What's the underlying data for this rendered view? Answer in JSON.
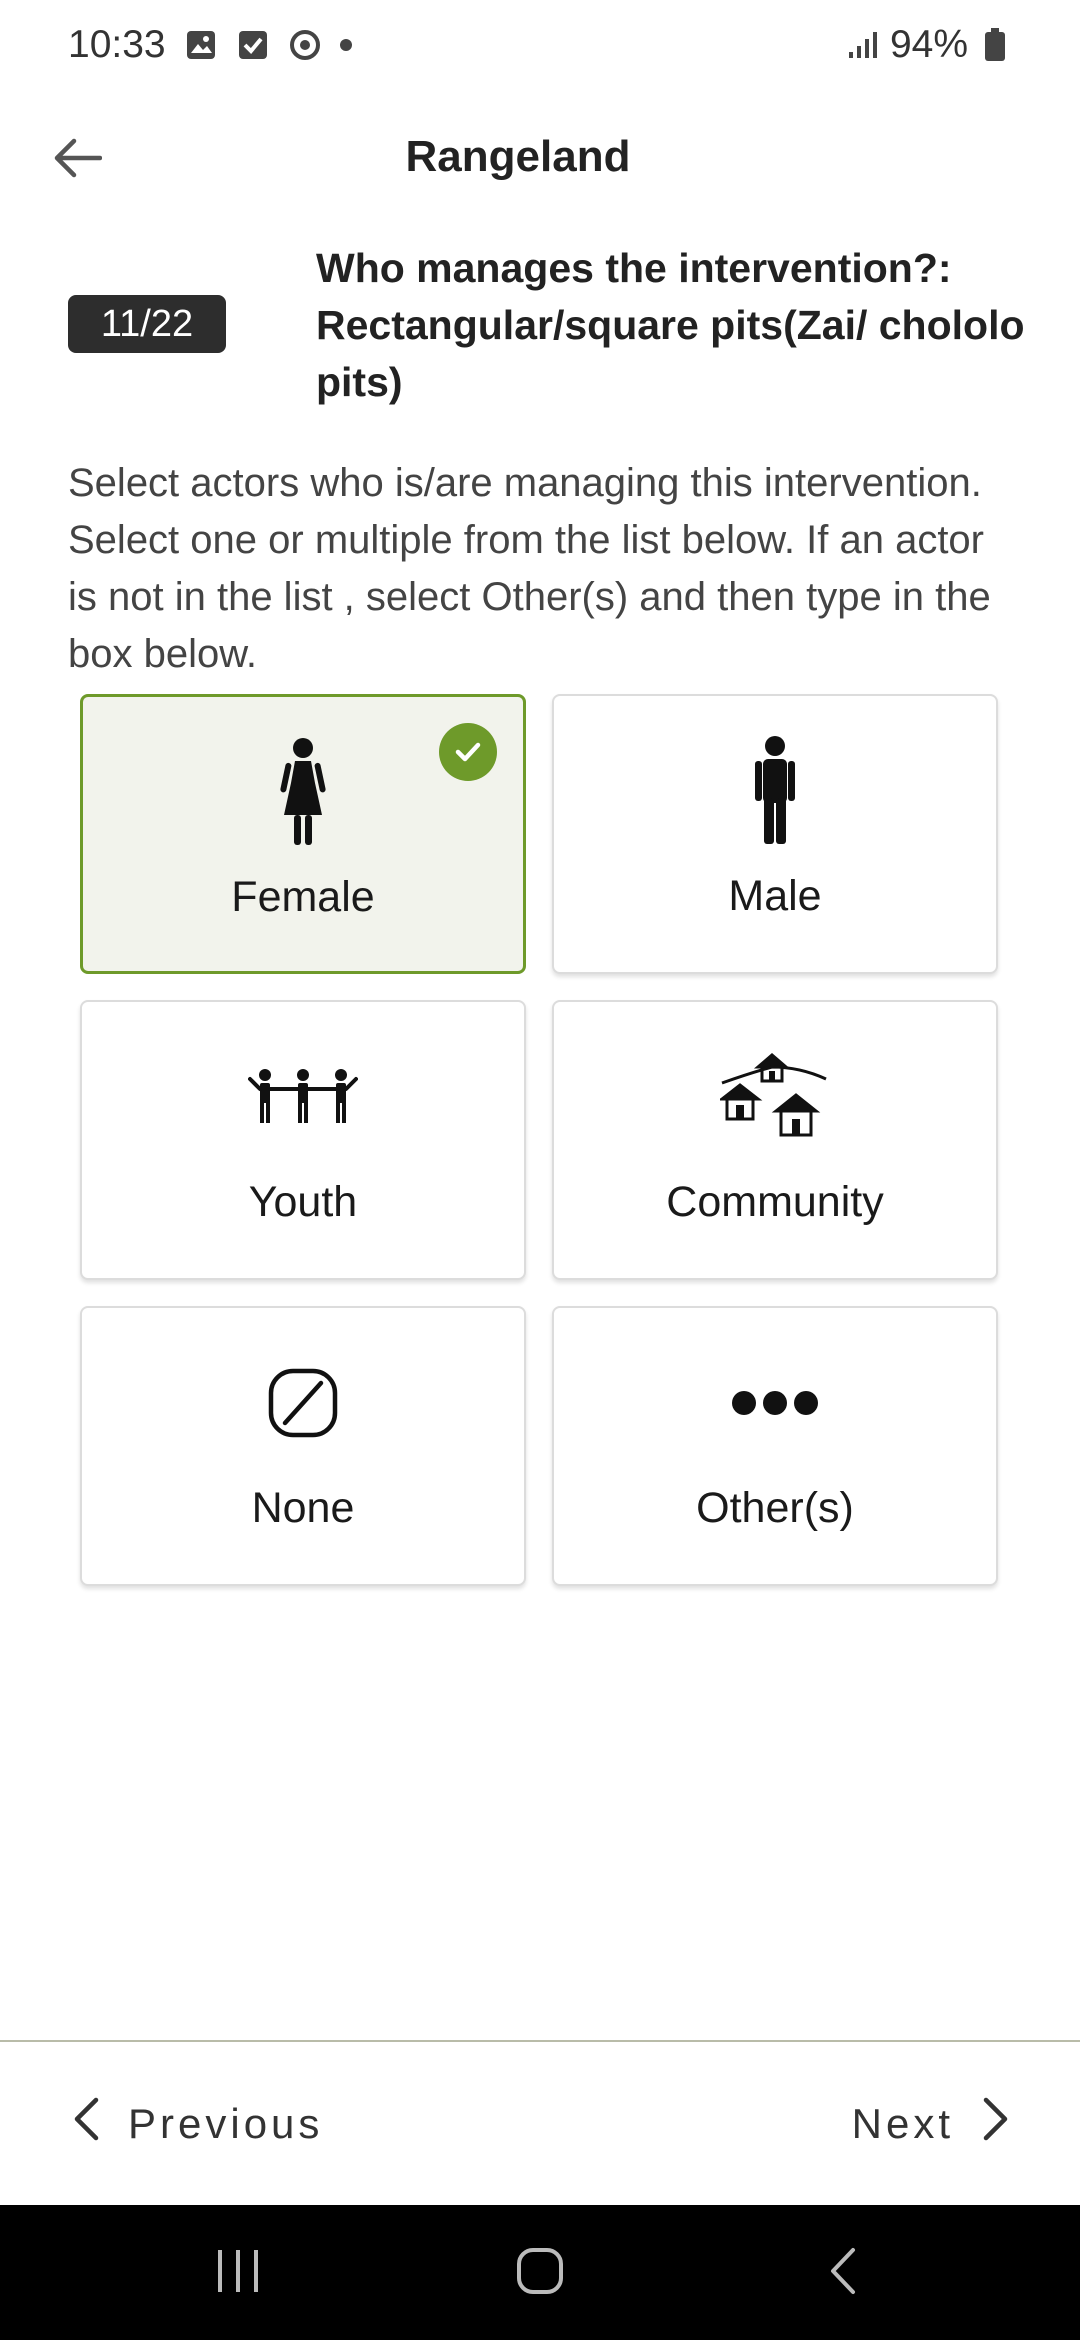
{
  "status_bar": {
    "time": "10:33",
    "battery": "94%",
    "icons": [
      "image-icon",
      "checkbox-icon",
      "sync-icon",
      "dot-icon",
      "signal-icon",
      "battery-icon"
    ]
  },
  "app_bar": {
    "title": "Rangeland",
    "back_icon": "arrow-left-icon"
  },
  "question": {
    "progress": "11/22",
    "text": "Who manages the intervention?: Rectangular/square pits(Zai/ chololo pits)"
  },
  "instruction": "Select actors who is/are managing this intervention. Select one or multiple from the list below. If an actor is not in the list , select Other(s) and then type in the box below.",
  "options": [
    {
      "label": "Female",
      "icon": "female-icon",
      "selected": true
    },
    {
      "label": "Male",
      "icon": "male-icon",
      "selected": false
    },
    {
      "label": "Youth",
      "icon": "youth-icon",
      "selected": false
    },
    {
      "label": "Community",
      "icon": "community-icon",
      "selected": false
    },
    {
      "label": "None",
      "icon": "none-icon",
      "selected": false
    },
    {
      "label": "Other(s)",
      "icon": "more-icon",
      "selected": false
    }
  ],
  "navigation": {
    "previous_label": "Previous",
    "next_label": "Next"
  },
  "colors": {
    "accent": "#6e9a2a",
    "selected_bg": "#f2f3ec",
    "badge_bg": "#2d2d2d"
  }
}
